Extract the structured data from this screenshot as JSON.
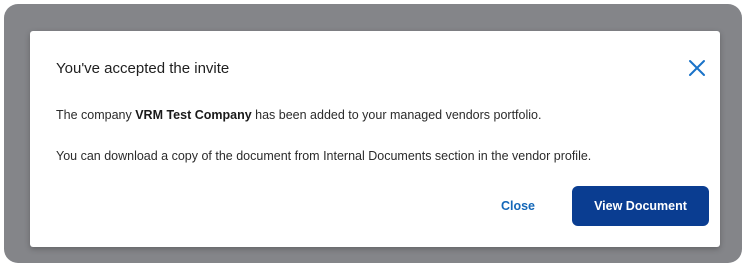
{
  "dialog": {
    "title": "You've accepted the invite",
    "message_prefix": "The company ",
    "company_name": "VRM Test Company",
    "message_suffix": " has been added to your managed vendors portfolio.",
    "download_note": "You can download a copy of the document from Internal Documents section in the vendor profile.",
    "close_label": "Close",
    "view_document_label": "View Document",
    "close_icon": "close-icon"
  },
  "colors": {
    "overlay": "#848589",
    "primary_button": "#0a3d91",
    "link_button": "#1467b8",
    "close_icon": "#1a73c8"
  }
}
